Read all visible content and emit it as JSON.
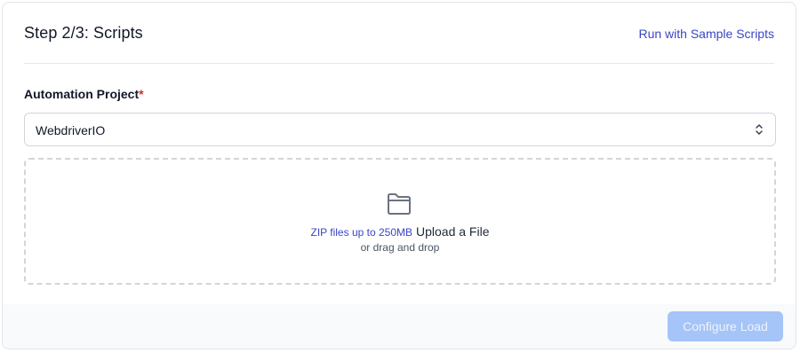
{
  "header": {
    "step_title": "Step 2/3: Scripts",
    "sample_link": "Run with Sample Scripts"
  },
  "automation_project": {
    "label": "Automation Project",
    "required_marker": "*",
    "selected_value": "WebdriverIO"
  },
  "upload": {
    "size_note": "ZIP files up to 250MB",
    "upload_label": "Upload a File",
    "drag_note": "or drag and drop",
    "icon": "folder-icon"
  },
  "footer": {
    "configure_label": "Configure Load",
    "configure_enabled": false
  },
  "colors": {
    "accent": "#3b46c4",
    "required": "#dc2626",
    "button_disabled": "#a5c4f7"
  }
}
